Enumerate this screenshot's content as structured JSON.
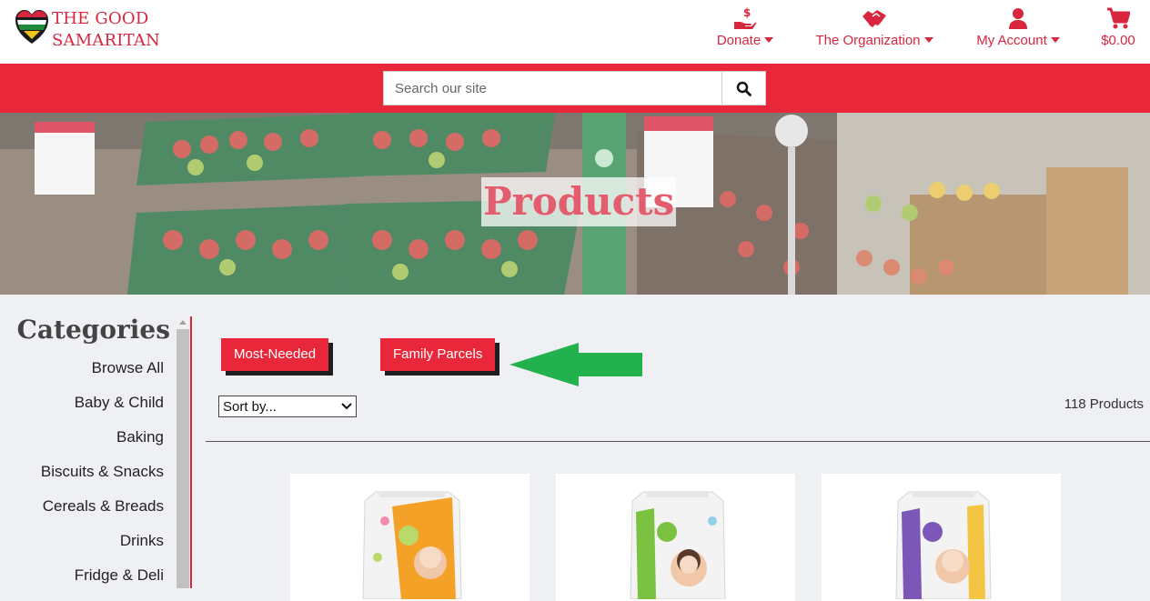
{
  "brand": {
    "line1": "THE GOOD",
    "line2": "SAMARITAN"
  },
  "nav": [
    {
      "label": "Donate",
      "icon": "hand-coin-icon"
    },
    {
      "label": "The Organization",
      "icon": "handshake-icon"
    },
    {
      "label": "My Account",
      "icon": "user-icon"
    },
    {
      "label": "$0.00",
      "icon": "cart-icon"
    }
  ],
  "search": {
    "placeholder": "Search our site"
  },
  "hero": {
    "title": "Products"
  },
  "sidebar": {
    "title": "Categories",
    "items": [
      "Browse All",
      "Baby & Child",
      "Baking",
      "Biscuits & Snacks",
      "Cereals & Breads",
      "Drinks",
      "Fridge & Deli"
    ]
  },
  "filters": {
    "most_needed": "Most-Needed",
    "family_parcels": "Family Parcels"
  },
  "sort": {
    "selected": "Sort by..."
  },
  "results": {
    "count": "118 Products"
  },
  "colors": {
    "brand_red": "#e8283a",
    "arrow_green": "#22b14c"
  }
}
